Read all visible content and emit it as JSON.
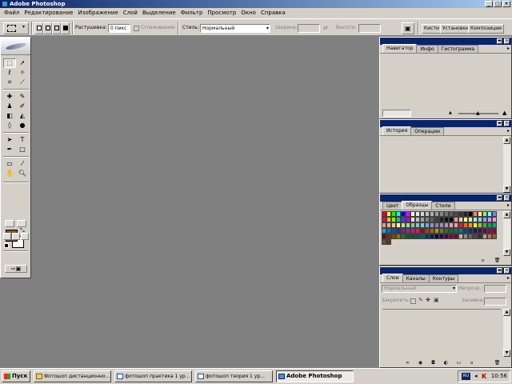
{
  "window": {
    "title": "Adobe Photoshop",
    "controls": [
      "_",
      "□",
      "×"
    ]
  },
  "menu": [
    "Файл",
    "Редактирование",
    "Изображение",
    "Слой",
    "Выделение",
    "Фильтр",
    "Просмотр",
    "Окно",
    "Справка"
  ],
  "options": {
    "feather_label": "Растушевка:",
    "feather_value": "0 пикс",
    "antialias_label": "Сглаживание",
    "style_label": "Стиль:",
    "style_value": "Нормальный",
    "width_label": "Ширина:",
    "height_label": "Высота:",
    "well_tabs": [
      "Кисти",
      "Установки",
      "Композиции"
    ]
  },
  "navigator": {
    "tabs": [
      "Навигатор",
      "Инфо",
      "Гистограмма"
    ]
  },
  "history": {
    "tabs": [
      "История",
      "Операции"
    ]
  },
  "swatches": {
    "tabs": [
      "Цвет",
      "Образцы",
      "Стили"
    ],
    "colors": [
      "#ff0000",
      "#ffff00",
      "#00ff00",
      "#00ffff",
      "#0000ff",
      "#ff00ff",
      "#ffffff",
      "#ebebeb",
      "#d7d7d7",
      "#c3c3c3",
      "#afafaf",
      "#9b9b9b",
      "#878787",
      "#737373",
      "#5f5f5f",
      "#4b4b4b",
      "#373737",
      "#232323",
      "#000000",
      "#ff8080",
      "#ffff80",
      "#80ff80",
      "#80ffff",
      "#8080ff",
      "#ff0040",
      "#ffc000",
      "#80ff00",
      "#00c0c0",
      "#4040ff",
      "#c000c0",
      "#e0e0e0",
      "#c0c0c0",
      "#a0a0a0",
      "#808080",
      "#606060",
      "#404040",
      "#202020",
      "#101010",
      "#000000",
      "#ff9999",
      "#ffcc99",
      "#ffff99",
      "#ccff99",
      "#99ffcc",
      "#99ccff",
      "#9999ff",
      "#cc99ff",
      "#ff99cc",
      "#f7977a",
      "#f9ad81",
      "#fdc68a",
      "#fff79a",
      "#c4df9b",
      "#a3d39c",
      "#82ca9d",
      "#7bcdc8",
      "#6ecff6",
      "#7ea7d8",
      "#8493ca",
      "#8882be",
      "#a187be",
      "#bc8dbf",
      "#f49ac2",
      "#f6989d",
      "#ed1c24",
      "#f26522",
      "#f7941d",
      "#fff200",
      "#8dc73f",
      "#39b54a",
      "#00a651",
      "#00a99d",
      "#00aeef",
      "#0072bc",
      "#0054a6",
      "#2e3192",
      "#662d91",
      "#92278f",
      "#ec008c",
      "#ed145b",
      "#9e0b0f",
      "#a0410d",
      "#a36209",
      "#aba000",
      "#598527",
      "#197b30",
      "#007236",
      "#00746b",
      "#0076a3",
      "#004b80",
      "#003471",
      "#1b1464",
      "#440e62",
      "#630460",
      "#9e005d",
      "#9e0039",
      "#790000",
      "#7b2e00",
      "#7d4900",
      "#827b00",
      "#406618",
      "#005e20",
      "#005826",
      "#005952",
      "#005b7f",
      "#003663",
      "#002157",
      "#0d004c",
      "#32004b",
      "#4b0049",
      "#7b0046",
      "#7a0026",
      "#c7b299",
      "#998675",
      "#736357",
      "#534741",
      "#37302a",
      "#c69c6d",
      "#a67c52",
      "#8c6239",
      "#754c24",
      "#603913"
    ]
  },
  "layers": {
    "tabs": [
      "Слои",
      "Каналы",
      "Контуры"
    ],
    "blend_mode": "Нормальный",
    "opacity_label": "Непрозр.:",
    "lock_label": "Закрепить:",
    "fill_label": "Заливка:"
  },
  "taskbar": {
    "start_label": "Пуск",
    "tasks": [
      "Фотошоп дистанционно...",
      "фотошоп практика 1 ур...",
      "фотошоп теория 1 ур...",
      "Adobe Photoshop"
    ],
    "lang": "RU",
    "clock": "10:56"
  },
  "colors": {
    "foreground": "#7b5a38",
    "background": "#ffffff",
    "workspace": "#808080",
    "titlebar": "#0a246a"
  }
}
